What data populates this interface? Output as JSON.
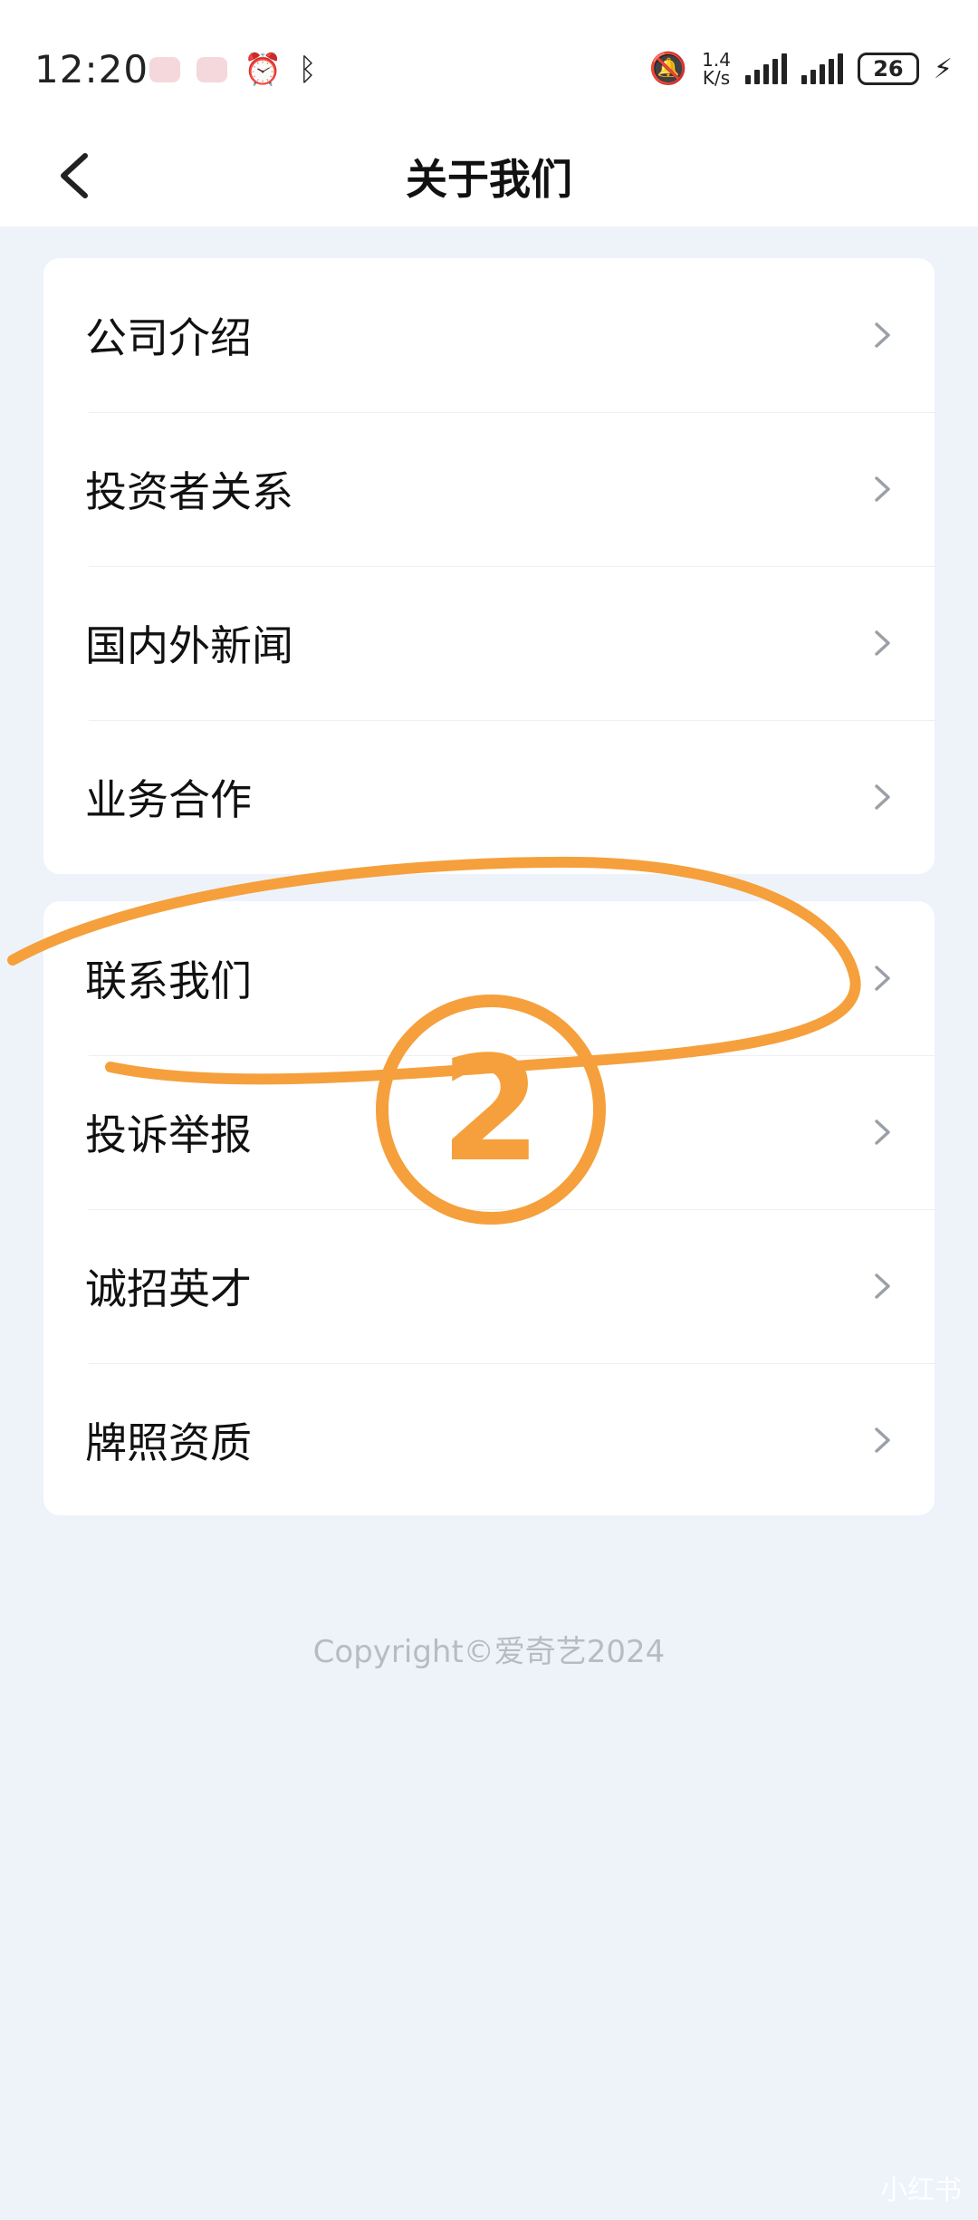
{
  "status_bar": {
    "time": "12:20",
    "net_speed_value": "1.4",
    "net_speed_unit": "K/s",
    "battery": "26"
  },
  "header": {
    "title": "关于我们"
  },
  "menu_group_1": [
    {
      "label": "公司介绍"
    },
    {
      "label": "投资者关系"
    },
    {
      "label": "国内外新闻"
    },
    {
      "label": "业务合作"
    }
  ],
  "menu_group_2": [
    {
      "label": "联系我们"
    },
    {
      "label": "投诉举报"
    },
    {
      "label": "诚招英才"
    },
    {
      "label": "牌照资质"
    }
  ],
  "footer": {
    "copyright": "Copyright©爱奇艺2024"
  },
  "annotation": {
    "step_number": "2",
    "color": "#f5a03c"
  },
  "watermark": "小红书"
}
